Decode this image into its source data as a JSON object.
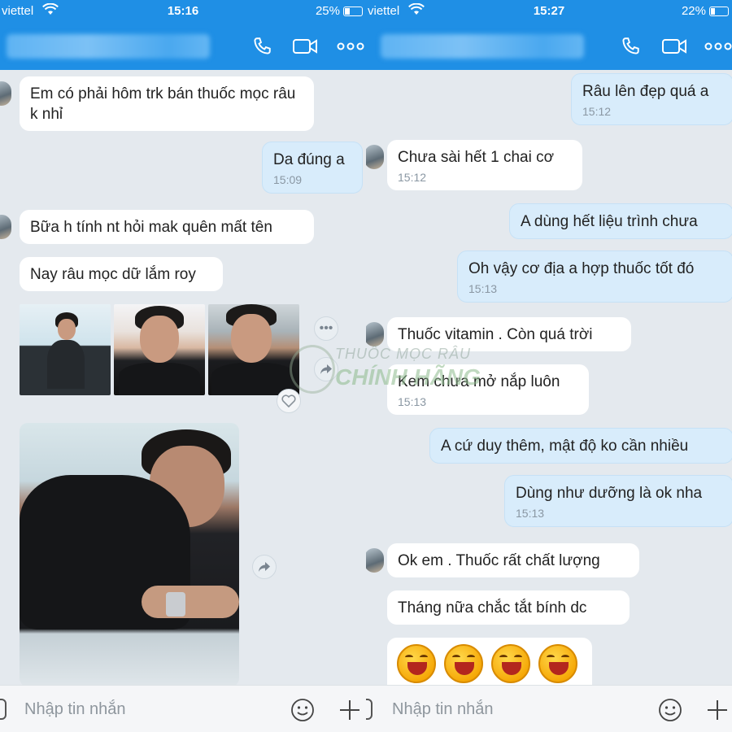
{
  "left": {
    "status": {
      "carrier": "viettel",
      "time": "15:16",
      "battery": "25%"
    },
    "messages": {
      "m1": "Em có phải hôm trk bán thuốc mọc râu k nhỉ",
      "m2": "Da đúng a",
      "m2_time": "15:09",
      "m3": "Bữa h tính nt hỏi mak quên mất tên",
      "m4": "Nay râu mọc dữ lắm roy"
    },
    "input_placeholder": "Nhập tin nhắn"
  },
  "right": {
    "status": {
      "carrier": "viettel",
      "time": "15:27",
      "battery": "22%"
    },
    "messages": {
      "r1": "Râu lên đẹp quá a",
      "r1_time": "15:12",
      "r2": "Chưa sài hết 1 chai cơ",
      "r2_time": "15:12",
      "r3": "A dùng hết liệu trình chưa",
      "r4": "Oh vậy cơ địa a hợp thuốc tốt đó",
      "r4_time": "15:13",
      "r5": "Thuốc vitamin . Còn quá trời",
      "r6": "Kem chưa mở nắp luôn",
      "r6_time": "15:13",
      "r7": "A cứ duy thêm, mật độ ko cần nhiều",
      "r8": "Dùng như dưỡng là ok nha",
      "r8_time": "15:13",
      "r9": "Ok em . Thuốc rất chất lượng",
      "r10": "Tháng nữa chắc tắt bính dc"
    },
    "input_placeholder": "Nhập tin nhắn"
  },
  "watermark": {
    "line1": "THUỐC MỌC RÂU",
    "line2": "CHÍNH HÃNG"
  },
  "icons": [
    "wifi-icon",
    "phone-icon",
    "video-call-icon",
    "more-icon",
    "share-icon",
    "heart-icon",
    "emoji-icon",
    "plus-icon"
  ],
  "colors": {
    "header": "#1f8fe5",
    "incoming": "#ffffff",
    "outgoing": "#d8ecfb",
    "background": "#e4e9ee"
  }
}
